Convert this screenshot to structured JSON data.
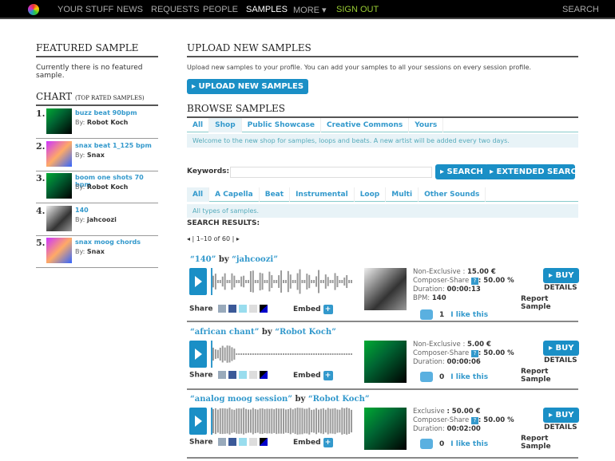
{
  "nav": {
    "items": [
      "YOUR STUFF",
      "NEWS",
      "REQUESTS",
      "PEOPLE",
      "SAMPLES",
      "MORE ▾",
      "SIGN OUT"
    ],
    "search": "SEARCH"
  },
  "featured": {
    "heading": "FEATURED SAMPLE",
    "text": "Currently there is no featured sample."
  },
  "chart": {
    "heading": "CHART",
    "sub": "(TOP RATED SAMPLES)",
    "by_label": "By:",
    "items": [
      {
        "num": "1.",
        "title": "buzz beat 90bpm",
        "artist": "Robot Koch"
      },
      {
        "num": "2.",
        "title": "snax beat 1_125 bpm",
        "artist": "Snax"
      },
      {
        "num": "3.",
        "title": "boom one shots 70 bpm",
        "artist": "Robot Koch"
      },
      {
        "num": "4.",
        "title": "140",
        "artist": "jahcoozi"
      },
      {
        "num": "5.",
        "title": "snax moog chords",
        "artist": "Snax"
      }
    ]
  },
  "upload": {
    "heading": "UPLOAD NEW SAMPLES",
    "text": "Upload new samples to your profile. You can add your samples to all your sessions on every session profile.",
    "button": "▸ UPLOAD NEW SAMPLES"
  },
  "browse": {
    "heading": "BROWSE SAMPLES",
    "tabs": [
      "All",
      "Shop",
      "Public Showcase",
      "Creative Commons",
      "Yours"
    ],
    "note": "Welcome to the new shop for samples, loops and beats. A new artist will be added every two days."
  },
  "search": {
    "label": "Keywords:",
    "value": "",
    "search": "▸ SEARCH",
    "extended": "▸ EXTENDED SEARCH"
  },
  "types": {
    "tabs": [
      "All",
      "A Capella",
      "Beat",
      "Instrumental",
      "Loop",
      "Multi",
      "Other Sounds"
    ],
    "note": "All types of samples."
  },
  "results": {
    "heading": "SEARCH RESULTS:",
    "pager": "◂ | 1–10 of 60 | ▸",
    "share": "Share",
    "embed": "Embed",
    "buy": "▸ BUY",
    "details": "DETAILS",
    "report": "Report Sample",
    "like": "I like this",
    "by": "by",
    "items": [
      {
        "title": "“140”",
        "artist": "“jahcoozi”",
        "l1": "Non-Exclusive : ",
        "p1": "15.00 €",
        "l2": "Composer-Share ",
        "p2": ": 50.00 %",
        "l3": "Duration: ",
        "p3": "00:00:13",
        "l4": "BPM: ",
        "p4": "140",
        "likes": "1"
      },
      {
        "title": "“african chant”",
        "artist": "“Robot Koch”",
        "l1": "Non-Exclusive : ",
        "p1": "5.00 €",
        "l2": "Composer-Share ",
        "p2": ": 50.00 %",
        "l3": "Duration: ",
        "p3": "00:00:06",
        "l4": "",
        "p4": "",
        "likes": "0"
      },
      {
        "title": "“analog moog session”",
        "artist": "“Robot Koch”",
        "l1": "Exclusive ",
        "p1": ": 50.00 €",
        "l2": "Composer-Share ",
        "p2": ": 50.00 %",
        "l3": "Duration: ",
        "p3": "00:02:00",
        "l4": "",
        "p4": "",
        "likes": "0"
      }
    ]
  }
}
